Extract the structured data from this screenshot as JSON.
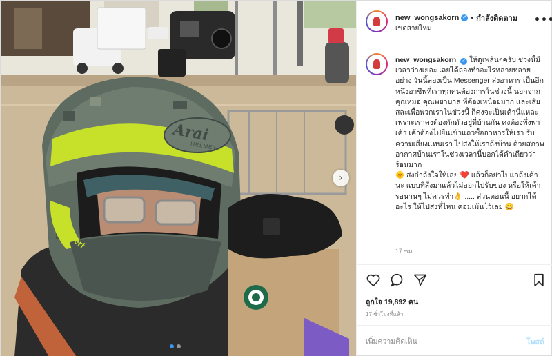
{
  "header": {
    "username": "new_wongsakorn",
    "verified_badge": "✓",
    "separator": "•",
    "follow_label": "กำลังติดตาม",
    "location": "เขตสายไหม",
    "more_icon": "more-options-icon"
  },
  "caption": {
    "username": "new_wongsakorn",
    "verified_badge": "✓",
    "text": "ให้ดูเพลินๆครับ ช่วงนี้มีเวลาว่างเยอะ เลยได้ลองทำอะไรหลายหลายอย่าง วันนี้ลองเป็น Messenger ส่งอาหาร เป็นอีกหนึ่งอาชีพที่เราทุกคนต้องการในช่วงนี้ นอกจากคุณหมอ คุณพยาบาล ที่ต้องเหนื่อยมาก และเสียสละเพื่อพวกเราในช่วงนี้ ก็คงจะเป็นเค้านี่แหละ เพราะเราคงต้องกักตัวอยู่ที่บ้านกัน คงต้องพึ่งพาเค้า เค้าต้องไปยืนเข้าแถวซื้ออาหารให้เรา รับความเสี่ยงแทนเรา ไปส่งให้เราถึงบ้าน ด้วยสภาพอากาศบ้านเราในช่วงเวลานี้บอกได้คำเดียวว่าร้อนมาก\n🌞 ส่งกำลังใจให้เลย ❤️ แล้วก็อย่าไปแกล้งเค้านะ แบบที่สั่งมาแล้วไม่ออกไปรับของ หรือให้เค้ารอนานๆ ไม่ควรทำ👌 ..... ส่วนตอนนี้ อยากได้อะไร ให้ไปส่งที่ไหน คอมเม้นไว้เลย 😄",
    "time_ago": "17 ชม."
  },
  "actions": {
    "like_icon": "heart-icon",
    "comment_icon": "comment-icon",
    "share_icon": "share-icon",
    "save_icon": "bookmark-icon"
  },
  "likes": {
    "text": "ถูกใจ 19,892 คน"
  },
  "posted_time": "17 ชั่วโมงที่แล้ว",
  "composer": {
    "placeholder": "เพิ่มความคิดเห็น",
    "post_label": "โพสต์"
  },
  "photo": {
    "helmet_brand": "Arai",
    "helmet_subtext": "HELMET",
    "helmet_side": "D-Perf",
    "carousel_count": 2,
    "carousel_active": 1
  }
}
